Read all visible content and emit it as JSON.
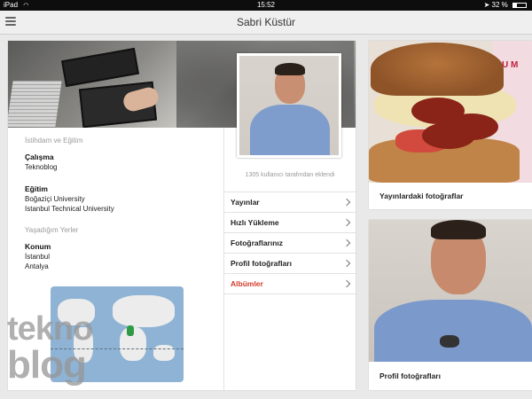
{
  "status_bar": {
    "device": "iPad",
    "time": "15:52",
    "battery_text": "32 %",
    "battery_level": 0.32,
    "wifi_icon": "wifi-icon",
    "location_icon": "location-arrow-icon"
  },
  "header": {
    "title": "Sabri Küstür",
    "menu_icon": "hamburger-menu-icon"
  },
  "profile": {
    "education_section_title": "İstihdam ve Eğitim",
    "work_label": "Çalışma",
    "work_value": "Teknoblog",
    "education_label": "Eğitim",
    "education_values": [
      "Boğaziçi University",
      "Istanbul Technical University"
    ],
    "places_section_title": "Yaşadığım Yerler",
    "location_label": "Konum",
    "location_values": [
      "İstanbul",
      "Antalya"
    ],
    "added_by": "1305 kullanıcı tarafından eklendi"
  },
  "nav": {
    "items": [
      {
        "label": "Yayınlar",
        "accent": false
      },
      {
        "label": "Hızlı Yükleme",
        "accent": false
      },
      {
        "label": "Fotoğraflarınız",
        "accent": false
      },
      {
        "label": "Profil fotoğrafları",
        "accent": false
      },
      {
        "label": "Albümler",
        "accent": true
      }
    ],
    "accent_color": "#d23c2a"
  },
  "cards": [
    {
      "caption": "Yayınlardaki fotoğraflar"
    },
    {
      "caption": "Profil fotoğrafları"
    }
  ],
  "watermark": {
    "line1": "tekno",
    "line2": "blog"
  }
}
